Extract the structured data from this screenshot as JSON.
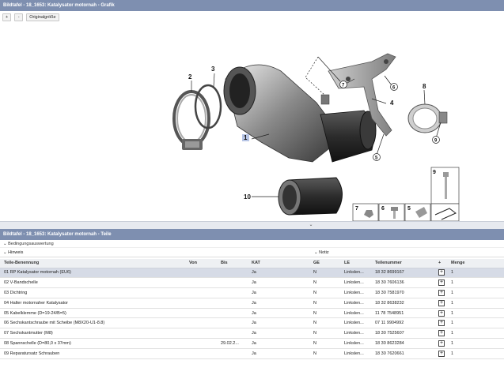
{
  "graphic_panel": {
    "title": "Bildtafel - 18_1653: Katalysator motornah - Grafik",
    "zoom_in_label": "+",
    "zoom_out_label": "-",
    "original_size_label": "Originalgröße"
  },
  "callouts": [
    "1",
    "2",
    "3",
    "4",
    "5",
    "6",
    "7",
    "8",
    "9",
    "10"
  ],
  "legend_callouts": [
    "7",
    "6",
    "5",
    "9"
  ],
  "parts_panel": {
    "title": "Bildtafel - 18_1653: Katalysator motornah - Teile",
    "conditions_label": "Bedingungsauswertung",
    "hint_label": "Hinweis",
    "notes_label": "Notiz",
    "columns": [
      "Teile-Benennung",
      "Von",
      "Bis",
      "KAT",
      "GE",
      "LE",
      "Teilenummer",
      "+",
      "Menge"
    ],
    "rows": [
      {
        "name": "01 RP Katalysator motornah (EU6)",
        "von": "",
        "bis": "",
        "kat": "Ja",
        "ge": "N",
        "le": "Linkslen...",
        "nr": "18 32 8699167",
        "menge": "1"
      },
      {
        "name": "02 V-Bandschelle",
        "von": "",
        "bis": "",
        "kat": "Ja",
        "ge": "N",
        "le": "Linkslen...",
        "nr": "18 30 7606136",
        "menge": "1"
      },
      {
        "name": "03 Dichtring",
        "von": "",
        "bis": "",
        "kat": "Ja",
        "ge": "N",
        "le": "Linkslen...",
        "nr": "18 30 7581970",
        "menge": "1"
      },
      {
        "name": "04 Halter motornaher Katalysator",
        "von": "",
        "bis": "",
        "kat": "Ja",
        "ge": "N",
        "le": "Linkslen...",
        "nr": "18 32 8638232",
        "menge": "1"
      },
      {
        "name": "05 Kabelklemme (D=19-24/B=5)",
        "von": "",
        "bis": "",
        "kat": "Ja",
        "ge": "N",
        "le": "Linkslen...",
        "nr": "11 78 7548951",
        "menge": "1"
      },
      {
        "name": "06 Sechskantschraube mit Scheibe (M8X20-U1-8.8)",
        "von": "",
        "bis": "",
        "kat": "Ja",
        "ge": "N",
        "le": "Linkslen...",
        "nr": "07 11 9904992",
        "menge": "1"
      },
      {
        "name": "07 Sechskantmutter (M8)",
        "von": "",
        "bis": "",
        "kat": "Ja",
        "ge": "N",
        "le": "Linkslen...",
        "nr": "18 30 7525607",
        "menge": "1"
      },
      {
        "name": "08 Spannschelle (D=80,0 x 37mm)",
        "von": "",
        "bis": "29.02.2...",
        "kat": "Ja",
        "ge": "N",
        "le": "Linkslen...",
        "nr": "18 30 8623284",
        "menge": "1"
      },
      {
        "name": "09 Reparatursatz Schrauben",
        "von": "",
        "bis": "",
        "kat": "Ja",
        "ge": "N",
        "le": "Linkslen...",
        "nr": "18 30 7620661",
        "menge": "1"
      }
    ],
    "add_symbol": "+"
  },
  "colors": {
    "header_bar": "#7e8fb0",
    "selected_row": "#d6dbe6"
  }
}
